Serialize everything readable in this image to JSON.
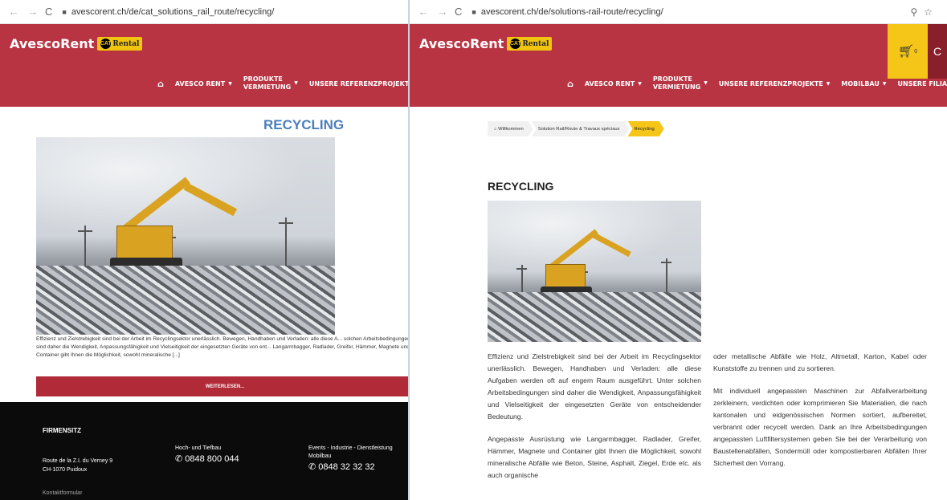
{
  "left": {
    "url": "avescorent.ch/de/cat_solutions_rail_route/recycling/",
    "logo_text": "AvescoRent",
    "logo_badge_cat": "CAT",
    "logo_badge_rental": "Rental",
    "menu": [
      {
        "label": "AVESCO RENT"
      },
      {
        "label_line1": "PRODUKTE",
        "label_line2": "VERMIETUNG"
      },
      {
        "label": "UNSERE REFERENZPROJEKTE"
      }
    ],
    "page_title": "RECYCLING",
    "excerpt": "Effizienz und Zielstrebigkeit sind bei der Arbeit im Recyclingsektor unerlässlich. Bewegen, Handhaben und Verladen: alle diese A... solchen Arbeitsbedingungen sind daher die Wendigkeit, Anpassungsfähigkeit und Vielseitigkeit der eingesetzten Geräte von ent... Langarmbagger, Radlader, Greifer, Hämmer, Magnete und Container gibt Ihnen die Möglichkeit, sowohl mineralische [...]",
    "read_more": "WEITERLESEN...",
    "footer": {
      "title": "FIRMENSITZ",
      "address_line1": "Route de la Z.I. du Verney 9",
      "address_line2": "CH-1070 Puidoux",
      "col1_title": "Hoch- und Tiefbau",
      "col1_phone": "0848 800 044",
      "col2_title": "Events - Industrie - Dienstleistung",
      "col2_sub": "Mobilbau",
      "col2_phone": "0848 32 32 32",
      "contact": "Kontaktformular"
    }
  },
  "right": {
    "url": "avescorent.ch/de/solutions-rail-route/recycling/",
    "logo_text": "AvescoRent",
    "logo_badge_cat": "CAT",
    "logo_badge_rental": "Rental",
    "cart_count": "0",
    "menu": [
      {
        "label": "AVESCO RENT"
      },
      {
        "label_line1": "PRODUKTE",
        "label_line2": "VERMIETUNG"
      },
      {
        "label": "UNSERE REFERENZPROJEKTE"
      },
      {
        "label": "MOBILBAU"
      },
      {
        "label": "UNSERE FILIALEN"
      }
    ],
    "breadcrumbs": [
      "Willkommen",
      "Solution Rail/Route & Travaux spéciaux",
      "Recycling"
    ],
    "page_title": "RECYCLING",
    "col1_p1": "Effizienz und Zielstrebigkeit sind bei der Arbeit im Recyclingsektor unerlässlich. Bewegen, Handhaben und Verladen: alle diese Aufgaben werden oft auf engem Raum ausgeführt. Unter solchen Arbeitsbedingungen sind daher die Wendigkeit, Anpassungsfähigkeit und Vielseitigkeit der eingesetzten Geräte von entscheidender Bedeutung.",
    "col1_p2": "Angepasste Ausrüstung wie Langarmbagger, Radlader, Greifer, Hämmer, Magnete und Container gibt Ihnen die Möglichkeit, sowohl mineralische Abfälle wie Beton, Steine, Asphalt, Ziegel, Erde etc. als auch organische",
    "col2_p1": "oder metallische Abfälle wie Holz, Altmetall, Karton, Kabel oder Kunststoffe zu trennen und zu sortieren.",
    "col2_p2": "Mit individuell angepassten Maschinen zur Abfallverarbeitung zerkleinern, verdichten oder komprimieren Sie Materialien, die nach kantonalen und eidgenössischen Normen sortiert, aufbereitet, verbrannt oder recycelt werden. Dank an Ihre Arbeitsbedingungen angepassten Luftfiltersystemen geben Sie bei der Verarbeitung von Baustellenabfällen, Sondermüll oder kompostierbaren Abfällen Ihrer Sicherheit den Vorrang."
  },
  "colors": {
    "brand_red": "#b93443",
    "accent_yellow": "#f5c518",
    "title_blue": "#4a7ebb"
  }
}
